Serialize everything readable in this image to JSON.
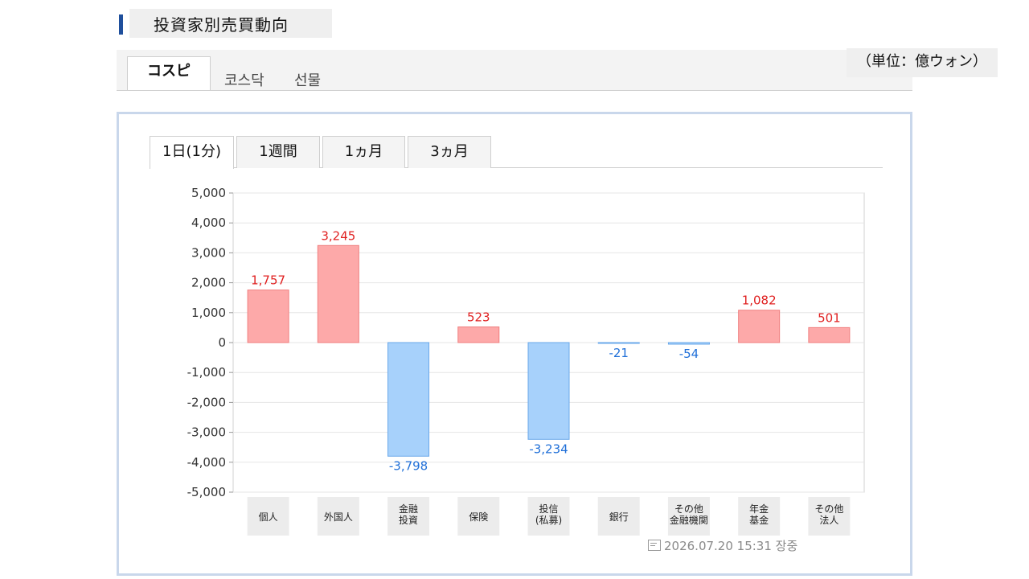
{
  "header": {
    "title": "投資家別売買動向",
    "unit": "（単位：億ウォン）"
  },
  "market_tabs": [
    {
      "label": "コスピ",
      "active": true
    },
    {
      "label": "코스닥",
      "active": false
    },
    {
      "label": "선물",
      "active": false
    }
  ],
  "period_tabs": [
    {
      "label": "1日(1分)",
      "active": true
    },
    {
      "label": "1週間",
      "active": false
    },
    {
      "label": "1ヵ月",
      "active": false
    },
    {
      "label": "3ヵ月",
      "active": false
    }
  ],
  "timestamp": "2026.07.20 15:31 장중",
  "colors": {
    "positive_fill": "#fda9a9",
    "positive_stroke": "#f07f7f",
    "positive_label": "#e02020",
    "negative_fill": "#a7d1fb",
    "negative_stroke": "#6aa8ea",
    "negative_label": "#1f6fd8",
    "accent": "#1f4f9c"
  },
  "chart_data": {
    "type": "bar",
    "categories": [
      [
        "個人"
      ],
      [
        "外国人"
      ],
      [
        "金融",
        "投資"
      ],
      [
        "保険"
      ],
      [
        "投信",
        "(私募)"
      ],
      [
        "銀行"
      ],
      [
        "その他",
        "金融機関"
      ],
      [
        "年金",
        "基金"
      ],
      [
        "その他",
        "法人"
      ]
    ],
    "values": [
      1757,
      3245,
      -3798,
      523,
      -3234,
      -21,
      -54,
      1082,
      501
    ],
    "value_labels": [
      "1,757",
      "3,245",
      "-3,798",
      "523",
      "-3,234",
      "-21",
      "-54",
      "1,082",
      "501"
    ],
    "y_ticks": [
      5000,
      4000,
      3000,
      2000,
      1000,
      0,
      -1000,
      -2000,
      -3000,
      -4000,
      -5000
    ],
    "y_tick_labels": [
      "5,000",
      "4,000",
      "3,000",
      "2,000",
      "1,000",
      "0",
      "-1,000",
      "-2,000",
      "-3,000",
      "-4,000",
      "-5,000"
    ],
    "ylim": [
      -5000,
      5000
    ],
    "grid": true
  }
}
